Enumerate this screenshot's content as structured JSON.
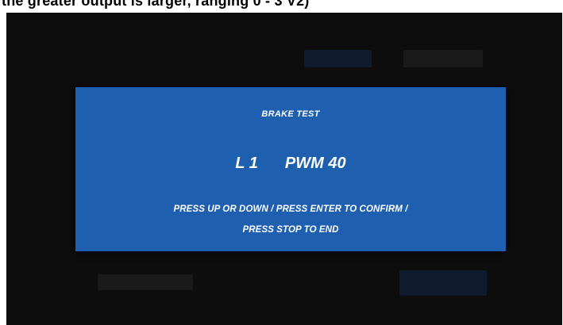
{
  "caption": {
    "text": "the greater output is larger, ranging 0 - 3 V2)"
  },
  "dialog": {
    "title": "BRAKE TEST",
    "level_label": "L 1",
    "pwm_label": "PWM 40",
    "instruction_line1": "PRESS UP OR DOWN  /  PRESS  ENTER TO CONFIRM /",
    "instruction_line2": "PRESS STOP TO END"
  },
  "colors": {
    "dialog_background": "#1e5fb0",
    "screen_background": "#0d0d0d",
    "dialog_text": "#ffffff"
  }
}
